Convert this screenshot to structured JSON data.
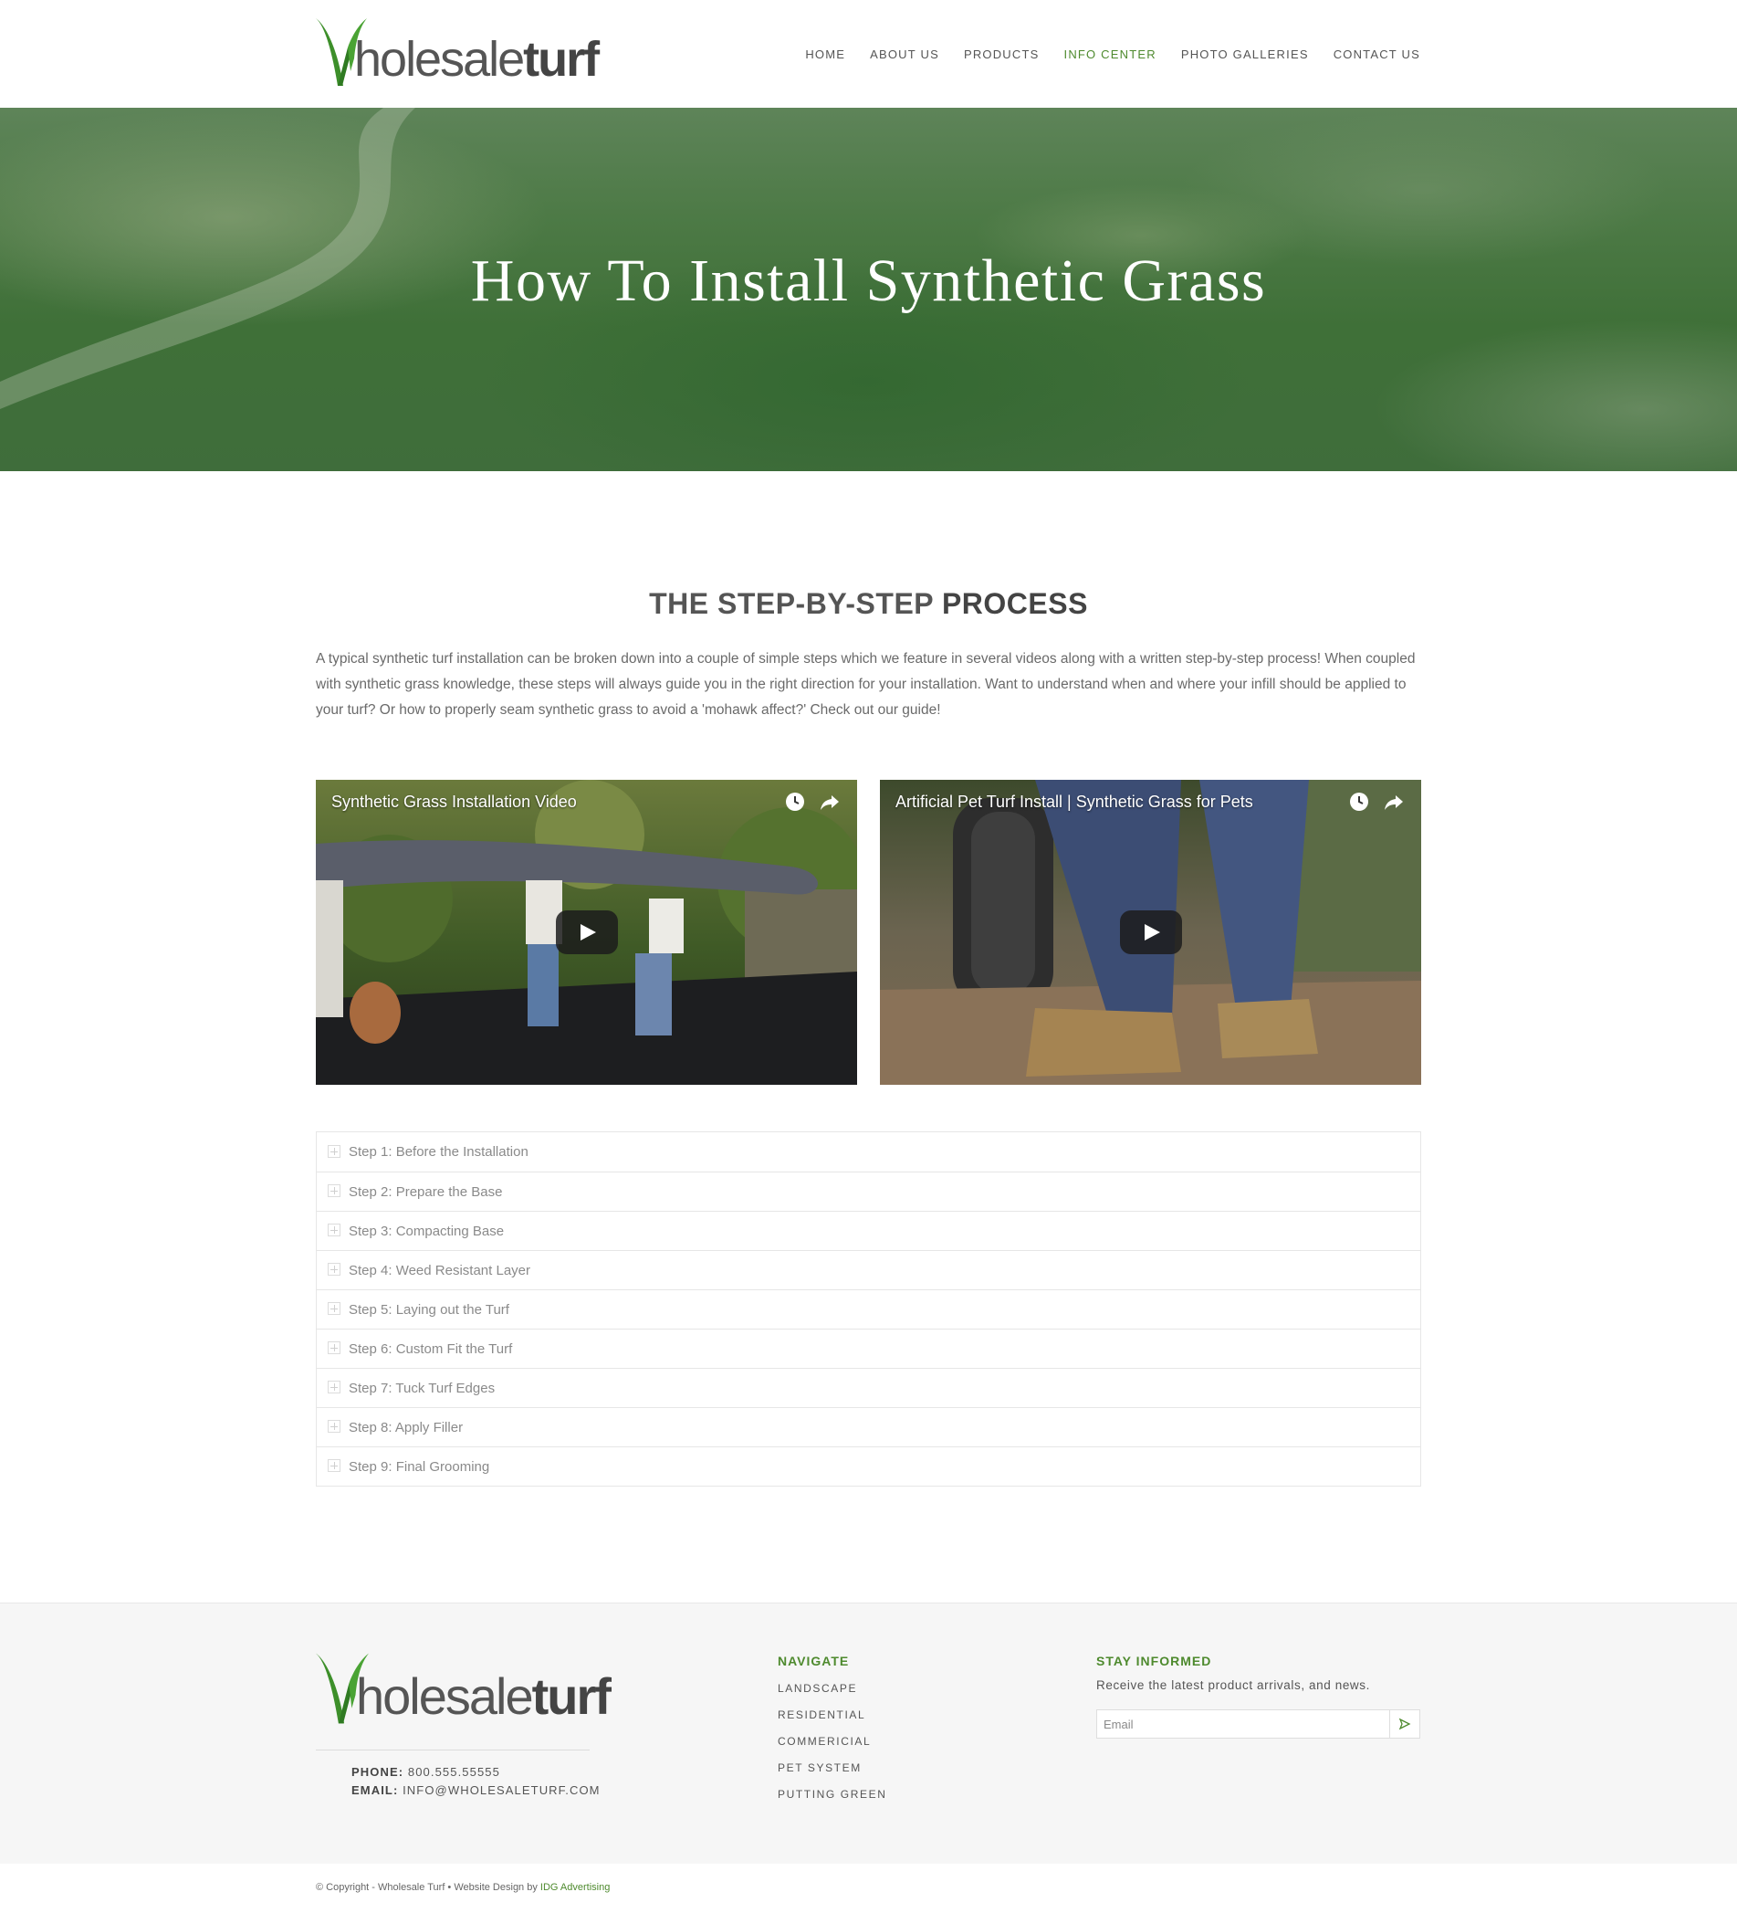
{
  "brand": {
    "logo_first": "holesale",
    "logo_bold": "turf",
    "accent": "#4e8a2e",
    "leaf": "#3d8f2a"
  },
  "nav": {
    "items": [
      {
        "label": "HOME"
      },
      {
        "label": "ABOUT US"
      },
      {
        "label": "PRODUCTS"
      },
      {
        "label": "INFO CENTER",
        "active": true
      },
      {
        "label": "PHOTO GALLERIES"
      },
      {
        "label": "CONTACT US"
      }
    ]
  },
  "hero": {
    "title": "How To Install Synthetic Grass"
  },
  "process": {
    "title_light": "THE STEP-BY-STEP ",
    "title_bold": "PROCESS",
    "intro": "A typical synthetic turf installation can be broken down into a couple of simple steps which we feature in several videos along with a written step-by-step process! When coupled with synthetic grass knowledge, these steps will always guide you in the right direction for your installation. Want to understand when and where your infill should be applied to your turf? Or how to properly seam synthetic grass to avoid a 'mohawk affect?' Check out our guide!"
  },
  "videos": [
    {
      "title": "Synthetic Grass Installation Video",
      "icons": [
        "clock-icon",
        "share-icon"
      ]
    },
    {
      "title": "Artificial Pet Turf Install | Synthetic Grass for Pets",
      "icons": [
        "clock-icon",
        "share-icon"
      ]
    }
  ],
  "steps": [
    {
      "label": "Step 1: Before the Installation"
    },
    {
      "label": "Step 2: Prepare the Base"
    },
    {
      "label": "Step 3: Compacting Base"
    },
    {
      "label": "Step 4: Weed Resistant Layer"
    },
    {
      "label": "Step 5: Laying out the Turf"
    },
    {
      "label": "Step 6: Custom Fit the Turf"
    },
    {
      "label": "Step 7: Tuck Turf Edges"
    },
    {
      "label": "Step 8: Apply Filler"
    },
    {
      "label": "Step 9: Final Grooming"
    }
  ],
  "footer": {
    "phone_label": "PHONE:",
    "phone": "800.555.55555",
    "email_label": "EMAIL:",
    "email": "INFO@WHOLESALETURF.COM",
    "navigate_title": "NAVIGATE",
    "navigate_items": [
      "LANDSCAPE",
      "RESIDENTIAL",
      "COMMERICIAL",
      "PET SYSTEM",
      "PUTTING GREEN"
    ],
    "stay_title": "STAY INFORMED",
    "stay_text": "Receive the latest product arrivals, and news.",
    "email_placeholder": "Email",
    "submit_icon": "send-arrow-icon"
  },
  "copyright": {
    "text": "© Copyright - Wholesale Turf • Website Design by ",
    "link": "IDG Advertising"
  }
}
